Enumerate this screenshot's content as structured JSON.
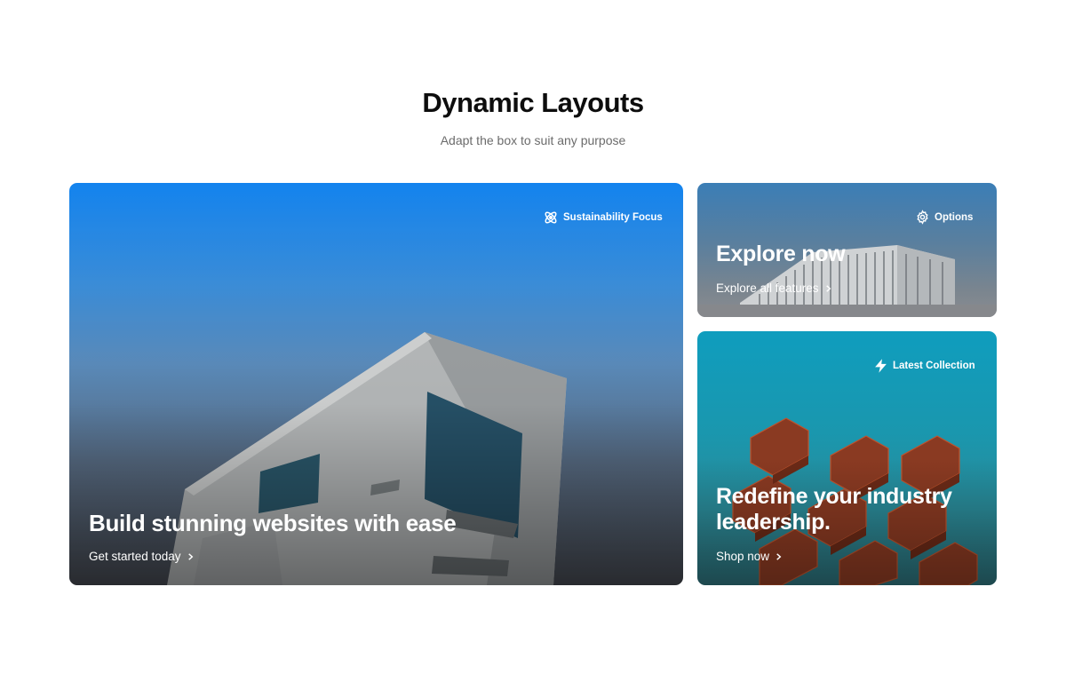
{
  "header": {
    "title": "Dynamic Layouts",
    "subtitle": "Adapt the box to suit any purpose"
  },
  "cards": [
    {
      "badge_icon": "atom-icon",
      "badge": "Sustainability Focus",
      "title": "Build stunning websites with ease",
      "link": "Get started today",
      "link_icon": "chevron-right-icon"
    },
    {
      "badge_icon": "gear-icon",
      "badge": "Options",
      "title": "Explore now",
      "link": "Explore all features",
      "link_icon": "chevron-right-icon"
    },
    {
      "badge_icon": "lightning-icon",
      "badge": "Latest Collection",
      "title_line1": "Redefine your industry",
      "title_line2": "leadership.",
      "link": "Shop now",
      "link_icon": "chevron-right-icon"
    }
  ],
  "colors": {
    "card_large_sky": "#1383ee",
    "card_bottom_sky": "#0f9dbe",
    "text_on_image": "#ffffff"
  }
}
